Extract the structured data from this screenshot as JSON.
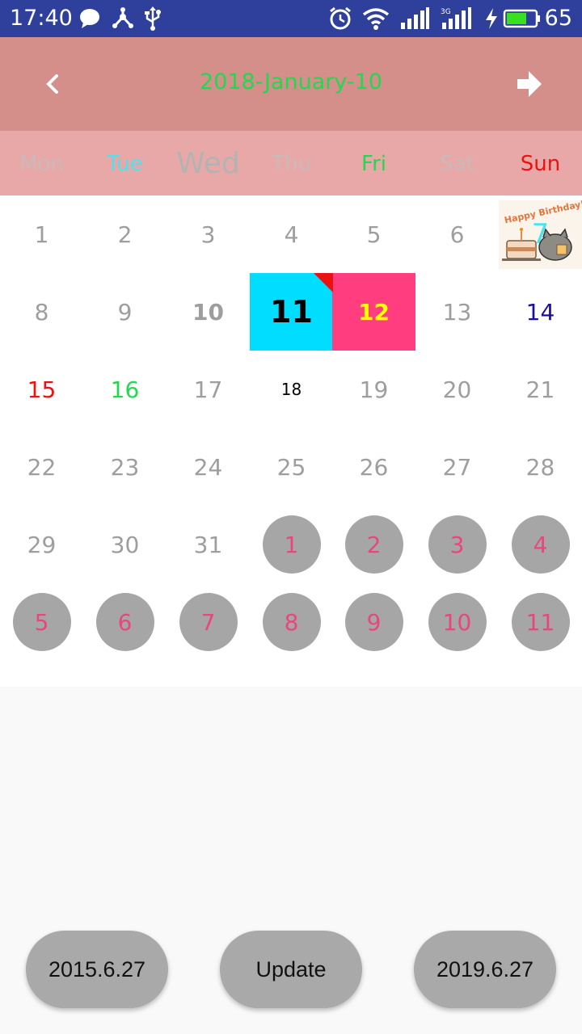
{
  "status_bar": {
    "time": "17:40",
    "battery": "65",
    "icons": [
      "chat-icon",
      "share-icon",
      "usb-icon",
      "alarm-icon",
      "wifi-icon",
      "signal-icon",
      "3g-signal-icon",
      "charging-icon",
      "battery-icon"
    ]
  },
  "header": {
    "title": "2018-January-10",
    "title_color": "#22d84e",
    "background": "#d48f8b"
  },
  "weekdays": [
    {
      "label": "Mon",
      "color": "#c9b9b9"
    },
    {
      "label": "Tue",
      "color": "#4de3ee"
    },
    {
      "label": "Wed",
      "color": "#b3b3b3"
    },
    {
      "label": "Thu",
      "color": "#c9b9b9"
    },
    {
      "label": "Fri",
      "color": "#22d84e"
    },
    {
      "label": "Sat",
      "color": "#c9b9b9"
    },
    {
      "label": "Sun",
      "color": "#ee1111"
    }
  ],
  "calendar": {
    "rows": [
      [
        "1",
        "2",
        "3",
        "4",
        "5",
        "6",
        "7"
      ],
      [
        "8",
        "9",
        "10",
        "11",
        "12",
        "13",
        "14"
      ],
      [
        "15",
        "16",
        "17",
        "18",
        "19",
        "20",
        "21"
      ],
      [
        "22",
        "23",
        "24",
        "25",
        "26",
        "27",
        "28"
      ],
      [
        "29",
        "30",
        "31",
        "1",
        "2",
        "3",
        "4"
      ],
      [
        "5",
        "6",
        "7",
        "8",
        "9",
        "10",
        "11"
      ]
    ],
    "birthday_badge_text": "Happy Birthday!",
    "colors": {
      "highlight_cyan": "#00ddff",
      "highlight_pink": "#ff3d7f",
      "sunday_blue": "#1a0fa3",
      "red": "#ee1111",
      "green": "#22d84e",
      "yellow": "#ffff00",
      "next_month_circle": "#a6a6a6",
      "next_month_text": "#e8477d"
    }
  },
  "buttons": {
    "left": "2015.6.27",
    "middle": "Update",
    "right": "2019.6.27"
  }
}
